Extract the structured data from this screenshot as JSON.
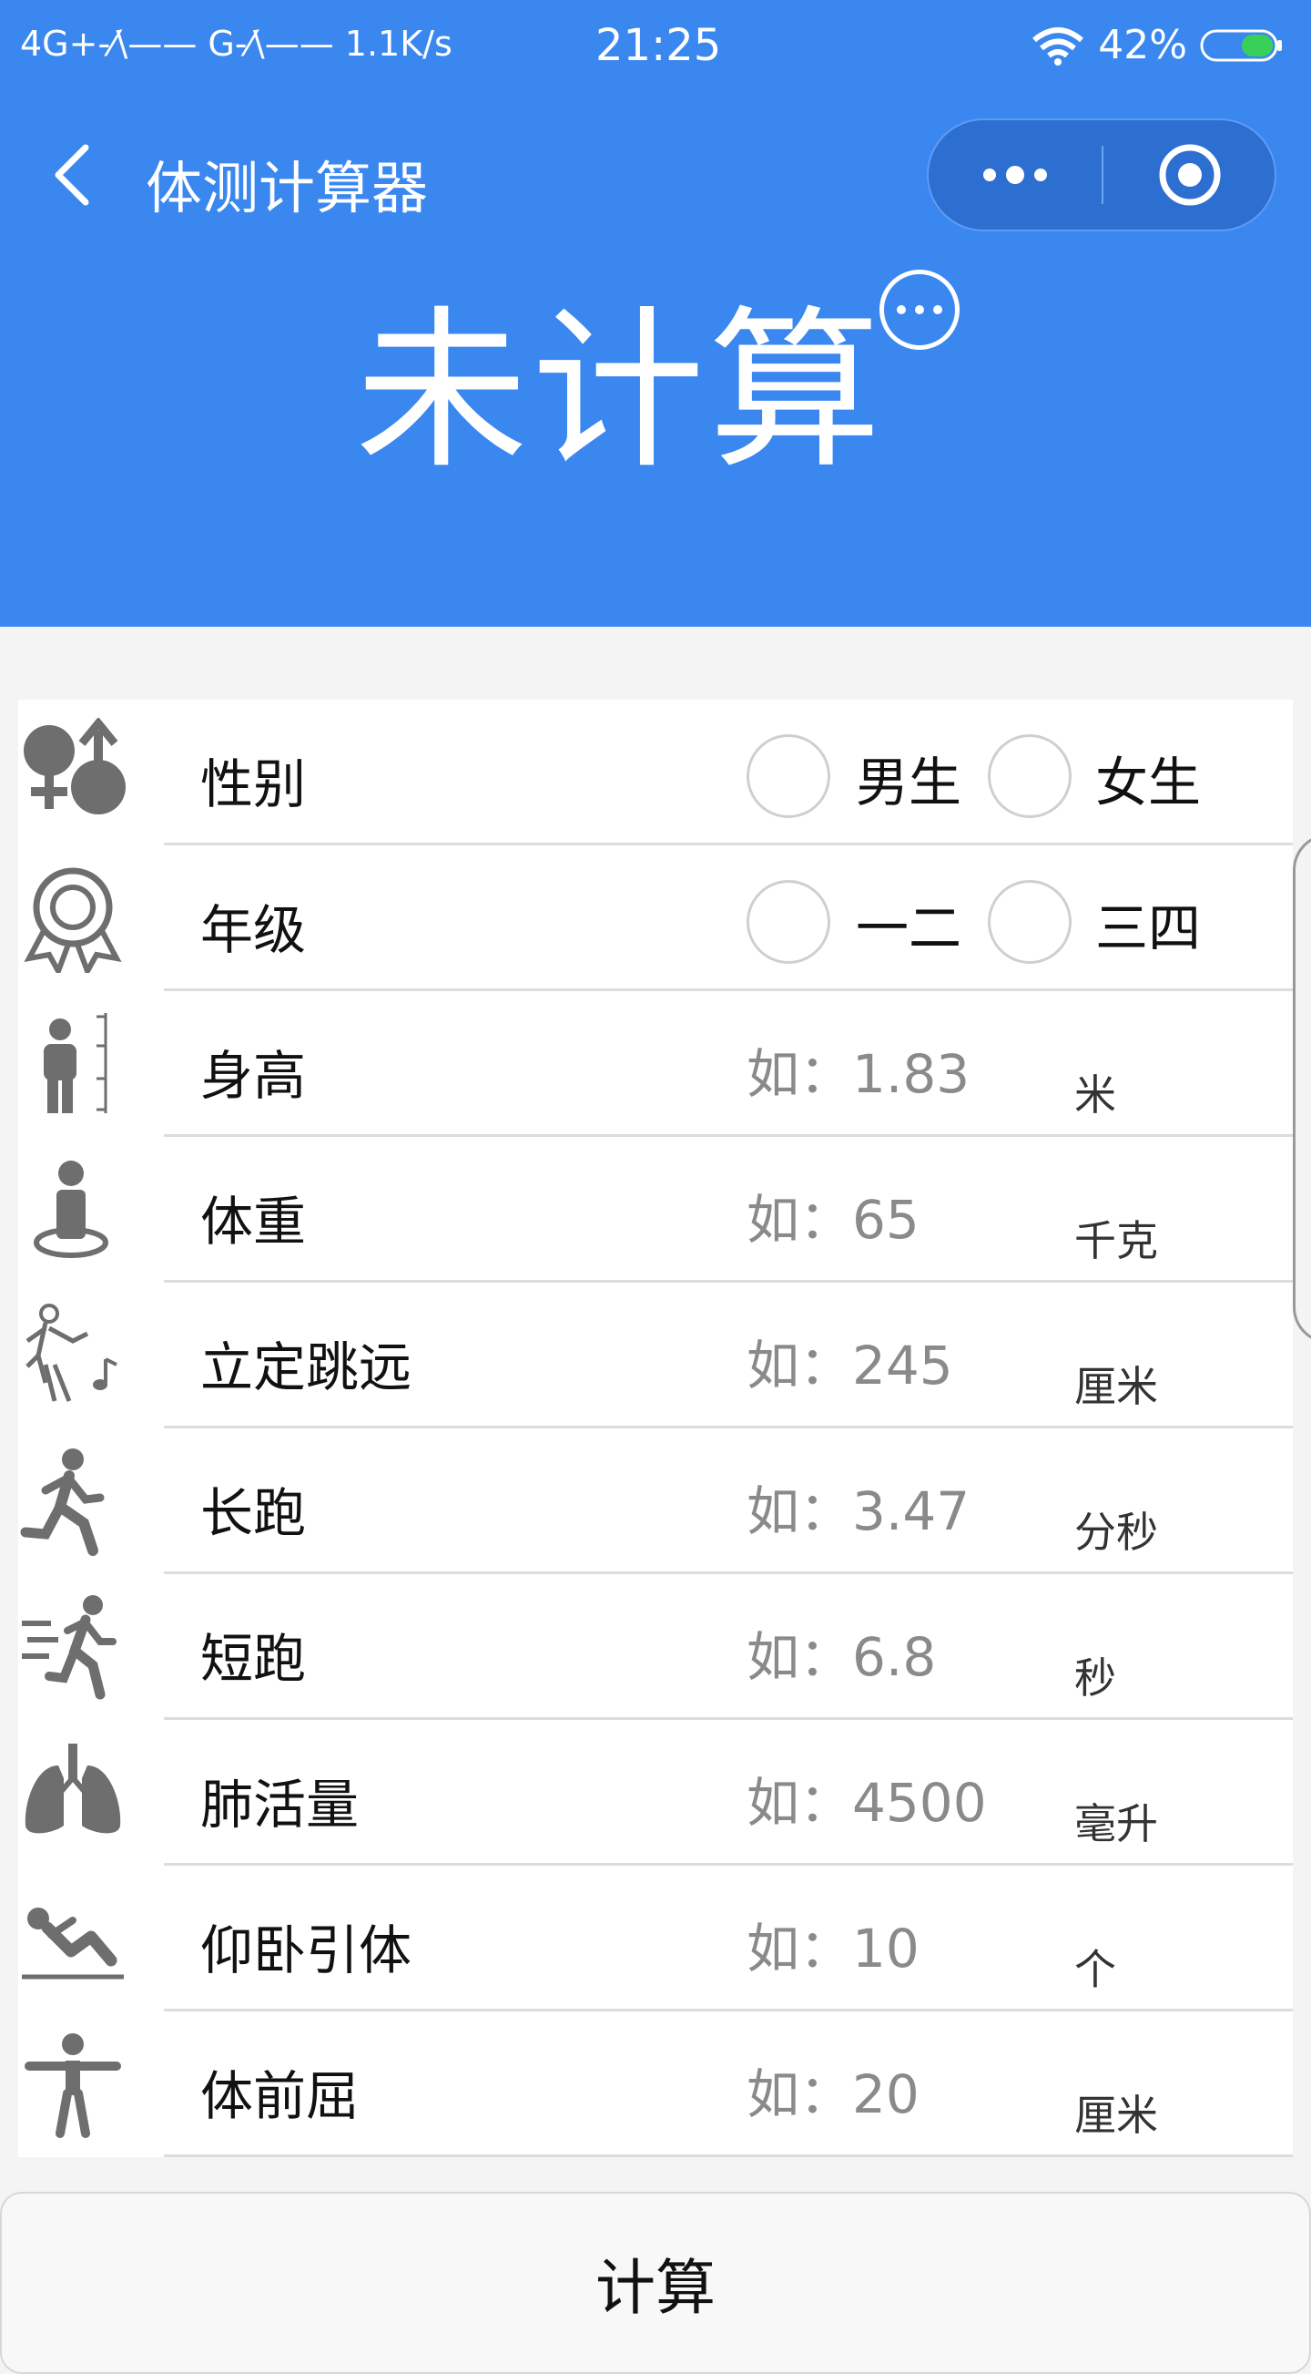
{
  "statusbar": {
    "network": "4G+-⁄\\—— G-⁄\\—— 1.1K/s",
    "time": "21:25",
    "battery": "42%"
  },
  "navbar": {
    "title": "体测计算器",
    "capsule_more_icon": "more-dots-icon",
    "capsule_close_icon": "target-circle-icon"
  },
  "result": {
    "title": "未计算",
    "more_icon": "ellipsis-circle-icon"
  },
  "form": {
    "gender": {
      "label": "性别",
      "icon": "gender-icon",
      "options": [
        "男生",
        "女生"
      ]
    },
    "grade": {
      "label": "年级",
      "icon": "medal-icon",
      "options": [
        "一二",
        "三四"
      ]
    },
    "fields": [
      {
        "label": "身高",
        "placeholder": "如：1.83",
        "unit": "米",
        "icon": "height-icon"
      },
      {
        "label": "体重",
        "placeholder": "如：65",
        "unit": "千克",
        "icon": "weight-icon"
      },
      {
        "label": "立定跳远",
        "placeholder": "如：245",
        "unit": "厘米",
        "icon": "dance-icon"
      },
      {
        "label": "长跑",
        "placeholder": "如：3.47",
        "unit": "分秒",
        "icon": "running-icon"
      },
      {
        "label": "短跑",
        "placeholder": "如：6.8",
        "unit": "秒",
        "icon": "sprint-icon"
      },
      {
        "label": "肺活量",
        "placeholder": "如：4500",
        "unit": "毫升",
        "icon": "lungs-icon"
      },
      {
        "label": "仰卧引体",
        "placeholder": "如：10",
        "unit": "个",
        "icon": "situp-icon"
      },
      {
        "label": "体前屈",
        "placeholder": "如：20",
        "unit": "厘米",
        "icon": "stretch-icon"
      }
    ]
  },
  "submit": {
    "label": "计算"
  },
  "colors": {
    "header": "#3a87f0",
    "icon": "#6e6e6e"
  }
}
